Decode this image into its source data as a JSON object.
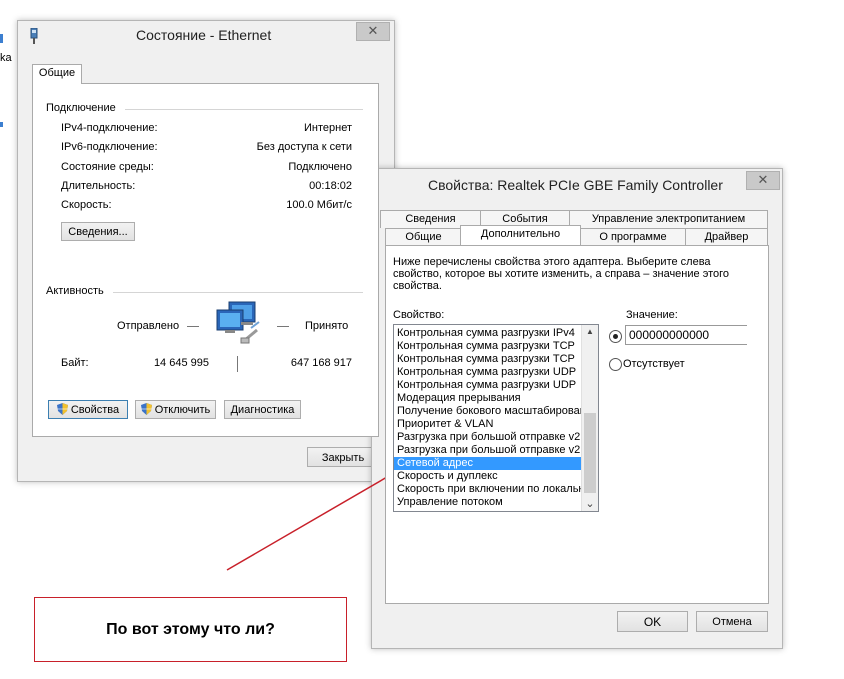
{
  "behind_window": {
    "fragments": [
      "ka"
    ]
  },
  "status_window": {
    "title": "Состояние - Ethernet",
    "tab": "Общие",
    "connection_header": "Подключение",
    "rows": [
      {
        "label": "IPv4-подключение:",
        "value": "Интернет"
      },
      {
        "label": "IPv6-подключение:",
        "value": "Без доступа к сети"
      },
      {
        "label": "Состояние среды:",
        "value": "Подключено"
      },
      {
        "label": "Длительность:",
        "value": "00:18:02"
      },
      {
        "label": "Скорость:",
        "value": "100.0 Мбит/с"
      }
    ],
    "details_button": "Сведения...",
    "activity_header": "Активность",
    "sent_label": "Отправлено",
    "received_label": "Принято",
    "bytes_label": "Байт:",
    "bytes_sent": "14 645 995",
    "bytes_received": "647 168 917",
    "properties_button": "Свойства",
    "disable_button": "Отключить",
    "diagnostics_button": "Диагностика",
    "close_button": "Закрыть"
  },
  "properties_window": {
    "title": "Свойства: Realtek PCIe GBE Family Controller",
    "tabs_back": [
      "Сведения",
      "События",
      "Управление электропитанием"
    ],
    "tabs_front": [
      "Общие",
      "Дополнительно",
      "О программе",
      "Драйвер"
    ],
    "description": "Ниже перечислены свойства этого адаптера. Выберите слева свойство, которое вы хотите изменить, а справа – значение этого свойства.",
    "property_label": "Свойство:",
    "value_label": "Значение:",
    "properties": [
      "Контрольная сумма разгрузки IPv4",
      "Контрольная сумма разгрузки TCP",
      "Контрольная сумма разгрузки TCP",
      "Контрольная сумма разгрузки UDP",
      "Контрольная сумма разгрузки UDP",
      "Модерация прерывания",
      "Получение бокового масштабирования",
      "Приоритет & VLAN",
      "Разгрузка при большой отправке v2",
      "Разгрузка при большой отправке v2",
      "Сетевой адрес",
      "Скорость и дуплекс",
      "Скорость при включении по локальной",
      "Управление потоком"
    ],
    "selected_index": 10,
    "value_input": "000000000000",
    "absent_label": "Отсутствует",
    "ok_button": "OK",
    "cancel_button": "Отмена"
  },
  "annotation": {
    "text": "По вот этому что ли?",
    "color": "#c8202a"
  }
}
